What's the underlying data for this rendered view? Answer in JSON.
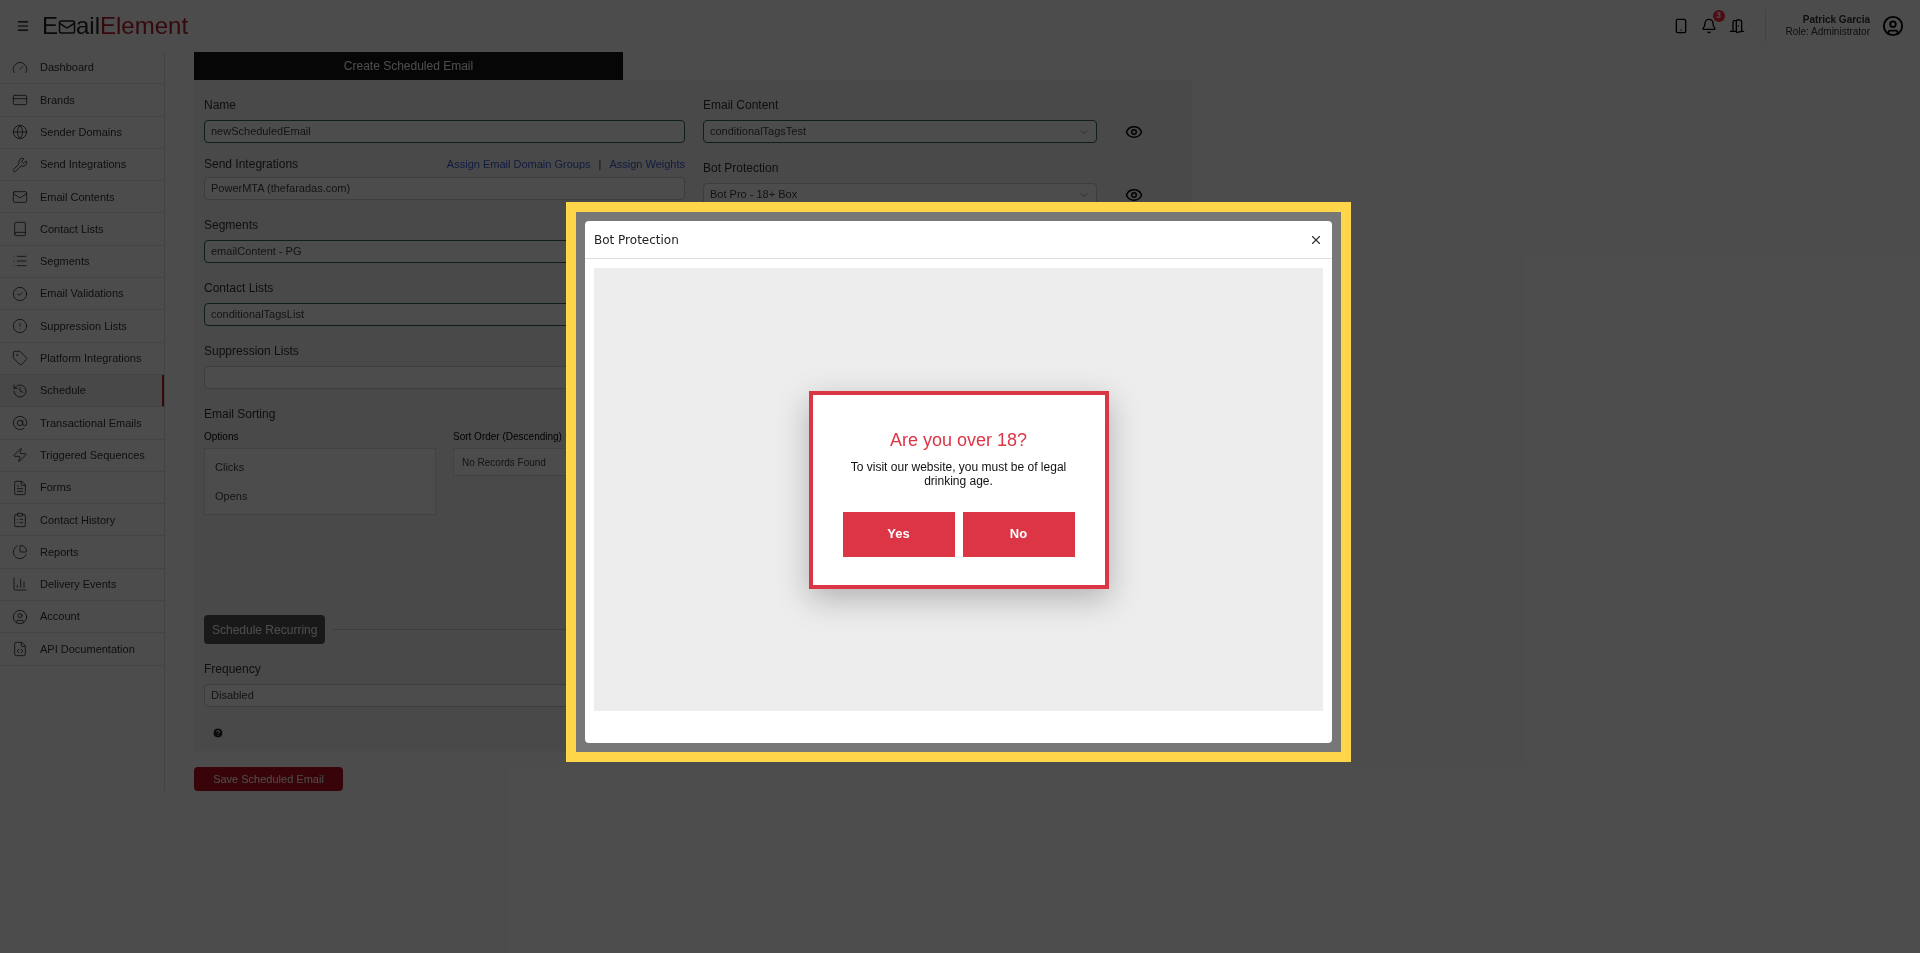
{
  "header": {
    "logo": {
      "start": "E",
      "middle": "ail",
      "end": "Element"
    },
    "notification_count": "3",
    "user": {
      "name": "Patrick Garcia",
      "role": "Role: Administrator"
    }
  },
  "sidebar": {
    "items": [
      {
        "label": "Dashboard",
        "selected": false
      },
      {
        "label": "Brands",
        "selected": false
      },
      {
        "label": "Sender Domains",
        "selected": false
      },
      {
        "label": "Send Integrations",
        "selected": false
      },
      {
        "label": "Email Contents",
        "selected": false
      },
      {
        "label": "Contact Lists",
        "selected": false
      },
      {
        "label": "Segments",
        "selected": false
      },
      {
        "label": "Email Validations",
        "selected": false
      },
      {
        "label": "Suppression Lists",
        "selected": false
      },
      {
        "label": "Platform Integrations",
        "selected": false
      },
      {
        "label": "Schedule",
        "selected": true
      },
      {
        "label": "Transactional Emails",
        "selected": false
      },
      {
        "label": "Triggered Sequences",
        "selected": false
      },
      {
        "label": "Forms",
        "selected": false
      },
      {
        "label": "Contact History",
        "selected": false
      },
      {
        "label": "Reports",
        "selected": false
      },
      {
        "label": "Delivery Events",
        "selected": false
      },
      {
        "label": "Account",
        "selected": false
      },
      {
        "label": "API Documentation",
        "selected": false
      }
    ]
  },
  "form": {
    "title": "Create Scheduled Email",
    "name": {
      "label": "Name",
      "value": "newScheduledEmail"
    },
    "send_integrations": {
      "label": "Send Integrations",
      "links": [
        "Assign Email Domain Groups",
        "Assign Weights"
      ],
      "separator": "|",
      "value": "PowerMTA (thefaradas.com)"
    },
    "segments": {
      "label": "Segments",
      "value": "emailContent - PG"
    },
    "contact_lists": {
      "label": "Contact Lists",
      "value": "conditionalTagsList"
    },
    "suppression_lists": {
      "label": "Suppression Lists"
    },
    "email_sorting": {
      "label": "Email Sorting",
      "options_label": "Options",
      "options": [
        "Clicks",
        "Opens"
      ],
      "sort_order_label": "Sort Order (Descending)",
      "sort_order_empty": "No Records Found"
    },
    "schedule_recurring": "Schedule Recurring",
    "frequency": {
      "label": "Frequency",
      "value": "Disabled"
    },
    "email_content": {
      "label": "Email Content",
      "value": "conditionalTagsTest"
    },
    "bot_protection": {
      "label": "Bot Protection",
      "value": "Bot Pro - 18+ Box"
    },
    "save_button": "Save Scheduled Email"
  },
  "modal": {
    "title": "Bot Protection",
    "age_gate": {
      "heading": "Are you over 18?",
      "text": "To visit our website, you must be of legal drinking age.",
      "buttons": [
        "Yes",
        "No"
      ]
    }
  }
}
